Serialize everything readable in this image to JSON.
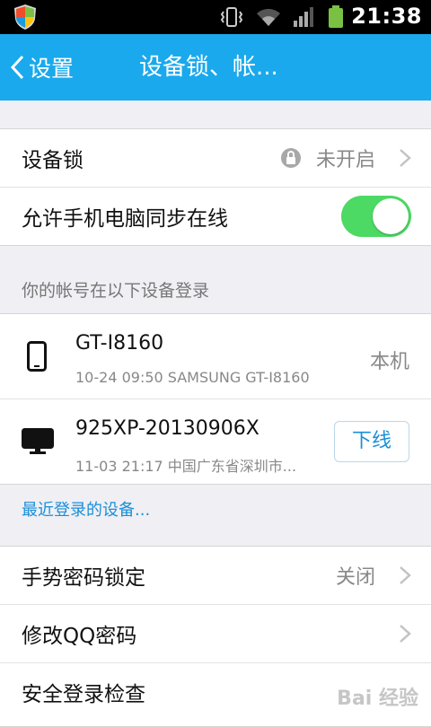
{
  "status_bar": {
    "time": "21:38",
    "icons": [
      "shield-icon",
      "vibrate-icon",
      "wifi-icon",
      "signal-icon",
      "battery-icon"
    ]
  },
  "header": {
    "back_label": "设置",
    "title": "设备锁、帐..."
  },
  "device_lock": {
    "label": "设备锁",
    "status": "未开启"
  },
  "sync_online": {
    "label": "允许手机电脑同步在线",
    "enabled": true
  },
  "devices_section": {
    "title": "你的帐号在以下设备登录",
    "devices": [
      {
        "name": "GT-I8160",
        "info": "10-24 09:50 SAMSUNG GT-I8160",
        "tag": "本机",
        "icon": "phone-icon"
      },
      {
        "name": "925XP-20130906X",
        "info": "11-03 21:17 中国广东省深圳市...",
        "action": "下线",
        "icon": "monitor-icon"
      }
    ],
    "recent_link": "最近登录的设备..."
  },
  "settings": {
    "gesture_lock": {
      "label": "手势密码锁定",
      "value": "关闭"
    },
    "change_password": {
      "label": "修改QQ密码"
    },
    "security_check": {
      "label": "安全登录检查"
    }
  },
  "watermark": "Bai 经验",
  "colors": {
    "accent": "#1aa9ec",
    "toggle_on": "#4cd964",
    "link": "#1a8fd8"
  }
}
